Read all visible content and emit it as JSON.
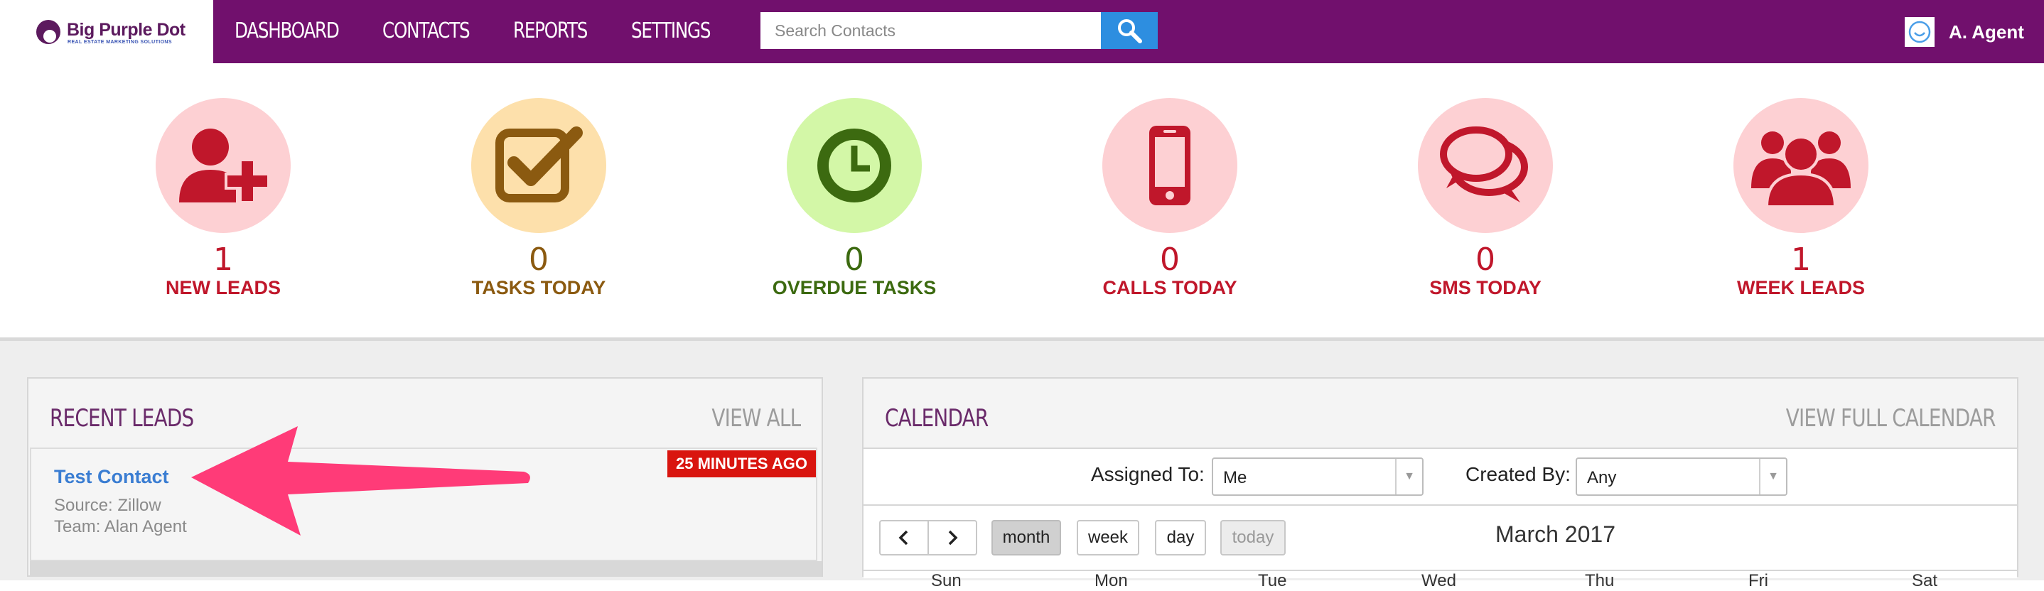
{
  "brand": {
    "name": "Big Purple Dot",
    "tagline": "REAL ESTATE MARKETING SOLUTIONS",
    "color": "#71106d"
  },
  "nav": {
    "items": [
      {
        "label": "DASHBOARD"
      },
      {
        "label": "CONTACTS"
      },
      {
        "label": "REPORTS"
      },
      {
        "label": "SETTINGS"
      }
    ]
  },
  "search": {
    "placeholder": "Search Contacts",
    "value": "",
    "icon": "search-icon"
  },
  "user": {
    "name": "A. Agent",
    "icon": "avatar-icon"
  },
  "stats": [
    {
      "count": "1",
      "label": "NEW LEADS",
      "icon": "add-user-icon",
      "circle": "#fdd0d3",
      "color": "#c0172b"
    },
    {
      "count": "0",
      "label": "TASKS TODAY",
      "icon": "checkbox-icon",
      "circle": "#fde0ab",
      "color": "#8b5a10"
    },
    {
      "count": "0",
      "label": "OVERDUE TASKS",
      "icon": "clock-icon",
      "circle": "#d3f7a7",
      "color": "#3c6a10"
    },
    {
      "count": "0",
      "label": "CALLS TODAY",
      "icon": "mobile-phone-icon",
      "circle": "#fdd0d3",
      "color": "#c0172b"
    },
    {
      "count": "0",
      "label": "SMS TODAY",
      "icon": "chat-bubbles-icon",
      "circle": "#fdd0d3",
      "color": "#c0172b"
    },
    {
      "count": "1",
      "label": "WEEK LEADS",
      "icon": "group-icon",
      "circle": "#fdd0d3",
      "color": "#c0172b"
    }
  ],
  "recent_leads": {
    "title": "RECENT LEADS",
    "view_all": "VIEW ALL",
    "items": [
      {
        "name": "Test Contact",
        "source": "Source: Zillow",
        "team": "Team: Alan Agent",
        "badge": "25 MINUTES AGO"
      }
    ]
  },
  "calendar": {
    "title": "CALENDAR",
    "view_full": "VIEW FULL CALENDAR",
    "assigned_label": "Assigned To:",
    "assigned_value": "Me",
    "created_label": "Created By:",
    "created_value": "Any",
    "views": {
      "month": "month",
      "week": "week",
      "day": "day",
      "today": "today"
    },
    "month_title": "March 2017",
    "weekdays": [
      "Sun",
      "Mon",
      "Tue",
      "Wed",
      "Thu",
      "Fri",
      "Sat"
    ]
  }
}
